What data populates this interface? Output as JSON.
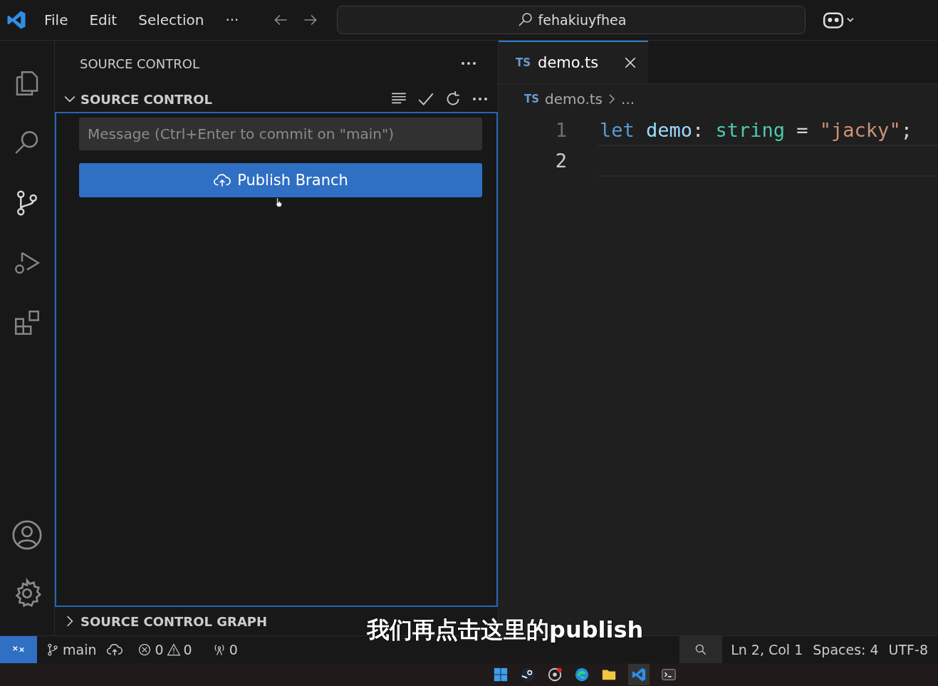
{
  "title_bar": {
    "menu": [
      "File",
      "Edit",
      "Selection",
      "···"
    ],
    "search": "fehakiuyfhea"
  },
  "activity_bar": [
    {
      "kind": "explorer",
      "selected": false
    },
    {
      "kind": "search",
      "selected": false
    },
    {
      "kind": "source-control",
      "selected": true
    },
    {
      "kind": "run",
      "selected": false
    },
    {
      "kind": "extensions",
      "selected": false
    }
  ],
  "sidebar": {
    "title": "SOURCE CONTROL",
    "section": {
      "label": "SOURCE CONTROL",
      "expanded": true
    },
    "message": {
      "placeholder": "Message (Ctrl+Enter to commit on \"main\")"
    },
    "publish_button": "Publish Branch",
    "graph_section": {
      "label": "SOURCE CONTROL GRAPH",
      "expanded": false
    }
  },
  "editor": {
    "tabs": [
      {
        "badge": "TS",
        "label": "demo.ts",
        "selected": true
      }
    ],
    "breadcrumb": {
      "badge": "TS",
      "file": "demo.ts",
      "rest": "..."
    },
    "lines": [
      {
        "number": "1",
        "tokens": [
          {
            "text": "let",
            "kind": "keyword"
          },
          {
            "text": "demo",
            "kind": "variable"
          },
          {
            "text": ": ",
            "kind": "punct"
          },
          {
            "text": "string",
            "kind": "type"
          },
          {
            "text": " = ",
            "kind": "punct"
          },
          {
            "text": "\"jacky\"",
            "kind": "string"
          },
          {
            "text": ";",
            "kind": "punct"
          }
        ]
      },
      {
        "number": "2"
      }
    ]
  },
  "status_bar": {
    "branch": "main",
    "errors": "0",
    "warnings": "0",
    "ports": "0",
    "position": "Ln 2, Col 1",
    "spaces": "Spaces: 4",
    "encoding": "UTF-8"
  },
  "caption": "我们再点击这里的publish"
}
